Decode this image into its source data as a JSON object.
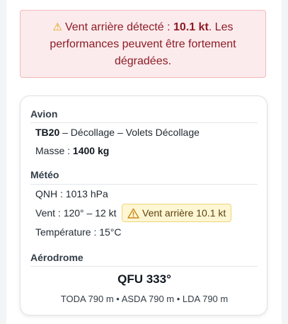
{
  "alert": {
    "prefix": "Vent arrière détecté : ",
    "value": "10.1 kt",
    "suffix": ". Les",
    "line2": "performances peuvent être fortement",
    "line3": "dégradées.",
    "icon": "warning-icon"
  },
  "aircraft": {
    "title": "Avion",
    "type": "TB20",
    "phase": " – Décollage – Volets Décollage",
    "mass_label": "Masse : ",
    "mass_value": "1400 kg"
  },
  "weather": {
    "title": "Météo",
    "qnh": "QNH : 1013 hPa",
    "wind": "Vent : 120° – 12 kt",
    "badge": "Vent arrière 10.1 kt",
    "badge_icon": "warning-outline-icon",
    "temperature": "Température : 15°C"
  },
  "airfield": {
    "title": "Aérodrome",
    "qfu": "QFU 333°",
    "distances": "TODA 790 m • ASDA 790 m • LDA 790 m"
  },
  "colors": {
    "alert_bg": "#fcebec",
    "alert_text": "#8c1c27",
    "badge_bg": "#fff6d4"
  }
}
